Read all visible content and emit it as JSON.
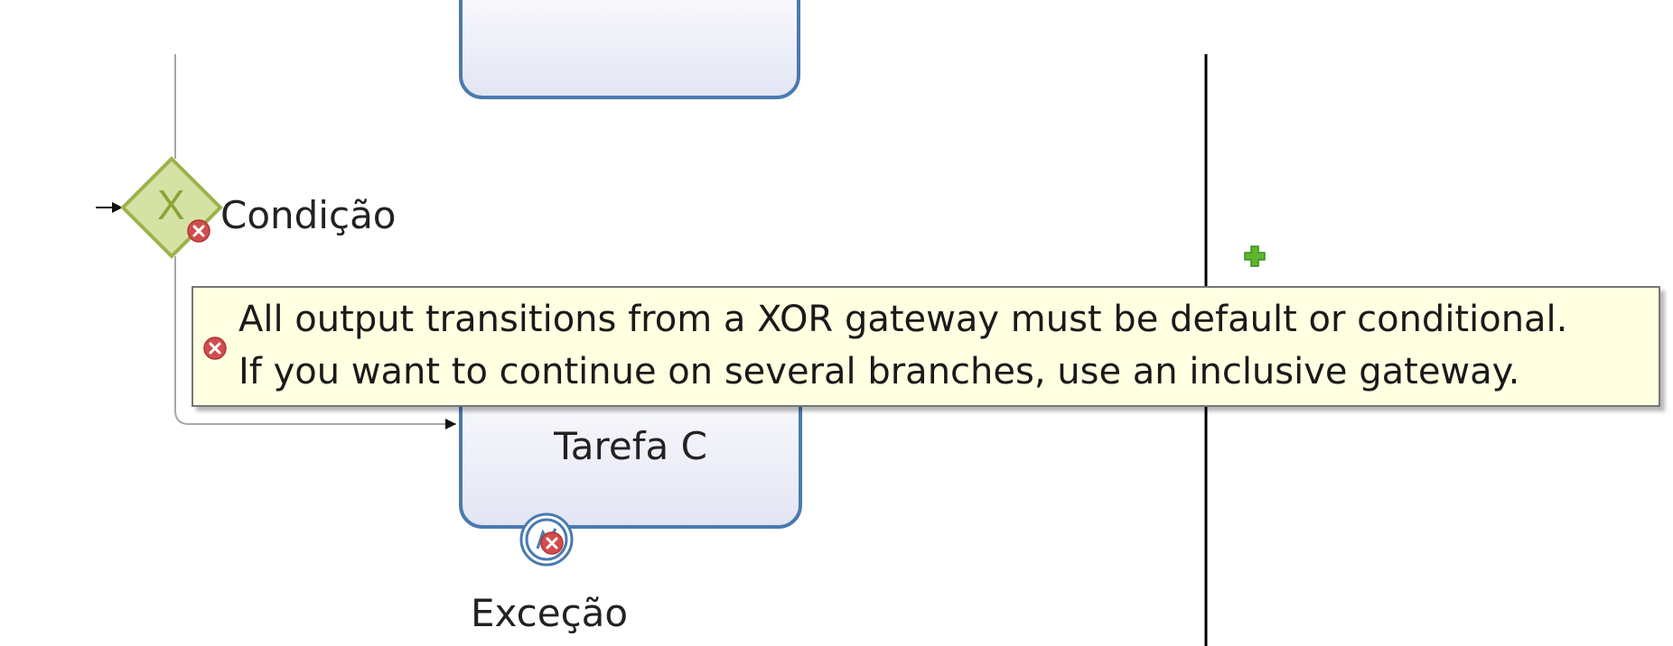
{
  "diagram": {
    "gateway": {
      "symbol": "X",
      "label": "Condição"
    },
    "task_c": {
      "label": "Tarefa C"
    },
    "boundary_event": {
      "label": "Exceção"
    },
    "tooltip": {
      "line1": "All output transitions from a XOR gateway must be default or conditional.",
      "line2": "If you want to continue on several branches, use an inclusive gateway."
    },
    "icons": [
      "error-icon",
      "add-icon",
      "error-marker-icon"
    ],
    "colors": {
      "task_border": "#4a7ab0",
      "gateway_fill": "#d6e2a4",
      "gateway_stroke": "#9cb24a",
      "error": "#d14d4d",
      "tooltip_bg": "#ffffe1",
      "add_icon": "#5cb82e",
      "pool_divider": "#000000"
    }
  }
}
